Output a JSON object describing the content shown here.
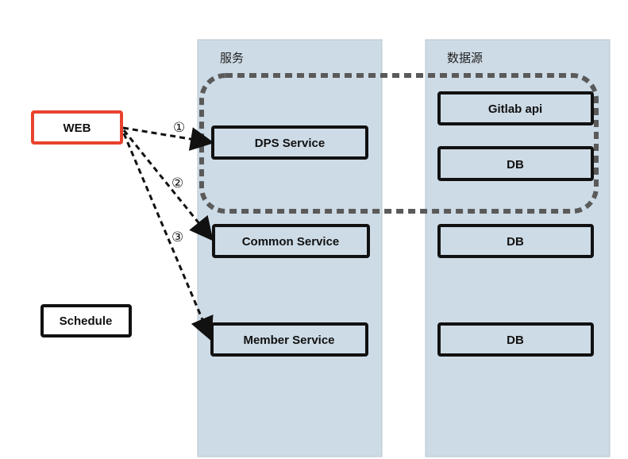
{
  "columns": {
    "services": {
      "title": "服务"
    },
    "datasources": {
      "title": "数据源"
    }
  },
  "nodes": {
    "web": "WEB",
    "schedule": "Schedule",
    "dps_service": "DPS Service",
    "common_service": "Common Service",
    "member_service": "Member Service",
    "gitlab_api": "Gitlab api",
    "db_dps": "DB",
    "db_common": "DB",
    "db_member": "DB"
  },
  "edges": [
    {
      "from": "web",
      "to": "dps_service",
      "label": "①"
    },
    {
      "from": "web",
      "to": "common_service",
      "label": "②"
    },
    {
      "from": "web",
      "to": "member_service",
      "label": "③"
    }
  ],
  "colors": {
    "column_fill": "#cddbe6",
    "web_border": "#e8432e",
    "group_border": "#5a5a5a"
  }
}
